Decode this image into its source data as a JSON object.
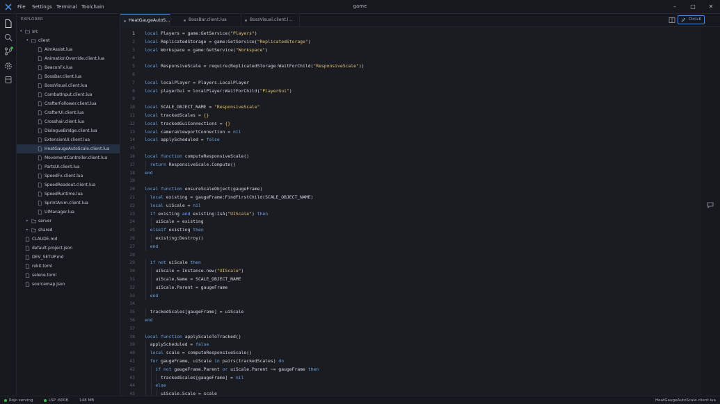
{
  "window": {
    "title": "game"
  },
  "menu": [
    "File",
    "Settings",
    "Terminal",
    "Toolchain"
  ],
  "explorer": {
    "title": "EXPLORER",
    "tree": [
      {
        "label": "src",
        "type": "folder",
        "depth": 0,
        "expanded": true
      },
      {
        "label": "client",
        "type": "folder",
        "depth": 1,
        "expanded": true
      },
      {
        "label": "AimAssist.lua",
        "type": "file",
        "depth": 2
      },
      {
        "label": "AnimationOverride.client.lua",
        "type": "file",
        "depth": 2
      },
      {
        "label": "BeaconFx.lua",
        "type": "file",
        "depth": 2
      },
      {
        "label": "BossBar.client.lua",
        "type": "file",
        "depth": 2
      },
      {
        "label": "BossVisual.client.lua",
        "type": "file",
        "depth": 2
      },
      {
        "label": "CombatInput.client.lua",
        "type": "file",
        "depth": 2
      },
      {
        "label": "CrafterFollower.client.lua",
        "type": "file",
        "depth": 2
      },
      {
        "label": "CrafterUI.client.lua",
        "type": "file",
        "depth": 2
      },
      {
        "label": "Crosshair.client.lua",
        "type": "file",
        "depth": 2
      },
      {
        "label": "DialogueBridge.client.lua",
        "type": "file",
        "depth": 2
      },
      {
        "label": "ExtensionUI.client.lua",
        "type": "file",
        "depth": 2
      },
      {
        "label": "HeatGaugeAutoScale.client.lua",
        "type": "file",
        "depth": 2,
        "selected": true
      },
      {
        "label": "MovementController.client.lua",
        "type": "file",
        "depth": 2
      },
      {
        "label": "PartsUI.client.lua",
        "type": "file",
        "depth": 2
      },
      {
        "label": "SpeedFx.client.lua",
        "type": "file",
        "depth": 2
      },
      {
        "label": "SpeedReadout.client.lua",
        "type": "file",
        "depth": 2
      },
      {
        "label": "SpeedRuntime.lua",
        "type": "file",
        "depth": 2
      },
      {
        "label": "SprintAnim.client.lua",
        "type": "file",
        "depth": 2
      },
      {
        "label": "UIManager.lua",
        "type": "file",
        "depth": 2
      },
      {
        "label": "server",
        "type": "folder",
        "depth": 1,
        "expanded": false
      },
      {
        "label": "shared",
        "type": "folder",
        "depth": 1,
        "expanded": false
      },
      {
        "label": "CLAUDE.md",
        "type": "file",
        "depth": 0
      },
      {
        "label": "default.project.json",
        "type": "file",
        "depth": 0
      },
      {
        "label": "DEV_SETUP.md",
        "type": "file",
        "depth": 0
      },
      {
        "label": "rokit.toml",
        "type": "file",
        "depth": 0
      },
      {
        "label": "selene.toml",
        "type": "file",
        "depth": 0
      },
      {
        "label": "sourcemap.json",
        "type": "file",
        "depth": 0
      }
    ]
  },
  "tabs": [
    {
      "label": "HeatGaugeAutoS…",
      "active": true
    },
    {
      "label": "BossBar.client.lua",
      "active": false
    },
    {
      "label": "BossVisual.client.l…",
      "active": false
    }
  ],
  "toolbar": {
    "command_palette_label": "Ctrl+K"
  },
  "editor": {
    "current_line": 1,
    "lines": [
      "local Players = game:GetService(\"Players\")",
      "local ReplicatedStorage = game:GetService(\"ReplicatedStorage\")",
      "local Workspace = game:GetService(\"Workspace\")",
      "",
      "local ResponsiveScale = require(ReplicatedStorage:WaitForChild(\"ResponsiveScale\"))",
      "",
      "local localPlayer = Players.LocalPlayer",
      "local playerGui = localPlayer:WaitForChild(\"PlayerGui\")",
      "",
      "local SCALE_OBJECT_NAME = \"ResponsiveScale\"",
      "local trackedScales = {}",
      "local trackedGuiConnections = {}",
      "local cameraViewportConnection = nil",
      "local applyScheduled = false",
      "",
      "local function computeResponsiveScale()",
      "  return ResponsiveScale.Compute()",
      "end",
      "",
      "local function ensureScaleObject(gaugeFrame)",
      "  local existing = gaugeFrame:FindFirstChild(SCALE_OBJECT_NAME)",
      "  local uiScale = nil",
      "  if existing and existing:IsA(\"UIScale\") then",
      "    uiScale = existing",
      "  elseif existing then",
      "    existing:Destroy()",
      "  end",
      "",
      "  if not uiScale then",
      "    uiScale = Instance.new(\"UIScale\")",
      "    uiScale.Name = SCALE_OBJECT_NAME",
      "    uiScale.Parent = gaugeFrame",
      "  end",
      "",
      "  trackedScales[gaugeFrame] = uiScale",
      "end",
      "",
      "local function applyScaleToTracked()",
      "  applyScheduled = false",
      "  local scale = computeResponsiveScale()",
      "  for gaugeFrame, uiScale in pairs(trackedScales) do",
      "    if not gaugeFrame.Parent or uiScale.Parent ~= gaugeFrame then",
      "      trackedScales[gaugeFrame] = nil",
      "    else",
      "      uiScale.Scale = scale"
    ]
  },
  "status": {
    "sync": "Rojo serving",
    "lsp": "LSP :6008",
    "memory": "148 MB",
    "file": "HeatGaugeAutoScale.client.lua"
  },
  "colors": {
    "accent": "#4f88d6",
    "keyword": "#6ea5e6",
    "string": "#e4c07a",
    "status_ok": "#3fb950"
  },
  "icons": [
    "app-logo-icon",
    "files-icon",
    "search-icon",
    "source-control-icon",
    "settings-icon",
    "database-icon",
    "split-editor-icon",
    "pencil-icon",
    "comment-icon",
    "folder-icon",
    "file-icon",
    "minimize-icon",
    "maximize-icon",
    "close-icon"
  ]
}
